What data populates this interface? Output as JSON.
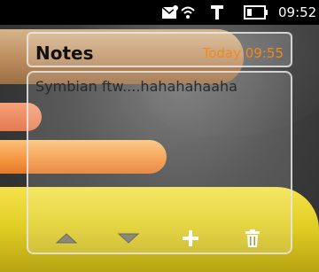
{
  "status_bar": {
    "time": "09:52",
    "icons": [
      "message-icon",
      "wifi-icon",
      "usb-icon",
      "battery-icon"
    ]
  },
  "widget": {
    "title": "Notes",
    "timestamp": "Today 09:55",
    "note_text": "Symbian ftw....hahahahaaha",
    "toolbar": [
      "arrow-up-icon",
      "arrow-down-icon",
      "add-icon",
      "delete-icon"
    ]
  },
  "colors": {
    "accent_orange": "#f08a1a",
    "status_bar_bg": "#000000"
  }
}
